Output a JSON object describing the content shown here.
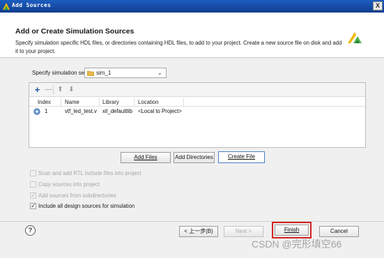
{
  "window": {
    "title": "Add Sources",
    "close_label": "X"
  },
  "header": {
    "title": "Add or Create Simulation Sources",
    "description": "Specify simulation specific HDL files, or directories containing HDL files, to add to your project. Create a new source file on disk and add it to your project."
  },
  "simset": {
    "label": "Specify simulation set:",
    "value": "sim_1"
  },
  "table": {
    "columns": [
      "Index",
      "Name",
      "Library",
      "Location"
    ],
    "rows": [
      {
        "index": "1",
        "name": "vtf_led_test.v",
        "library": "xil_defaultlib",
        "location": "<Local to Project>"
      }
    ]
  },
  "buttons": {
    "add_files": "Add Files",
    "add_directories": "Add Directories",
    "create_file": "Create File",
    "back": "< 上一步(B)",
    "next": "Next >",
    "finish": "Finish",
    "cancel": "Cancel",
    "help": "?"
  },
  "options": [
    {
      "label": "Scan and add RTL include files into project",
      "checked": false,
      "enabled": false
    },
    {
      "label": "Copy sources into project",
      "checked": false,
      "enabled": false
    },
    {
      "label": "Add sources from subdirectories",
      "checked": true,
      "enabled": false
    },
    {
      "label": "Include all design sources for simulation",
      "checked": true,
      "enabled": true
    }
  ],
  "watermark": "CSDN @完形填空66"
}
